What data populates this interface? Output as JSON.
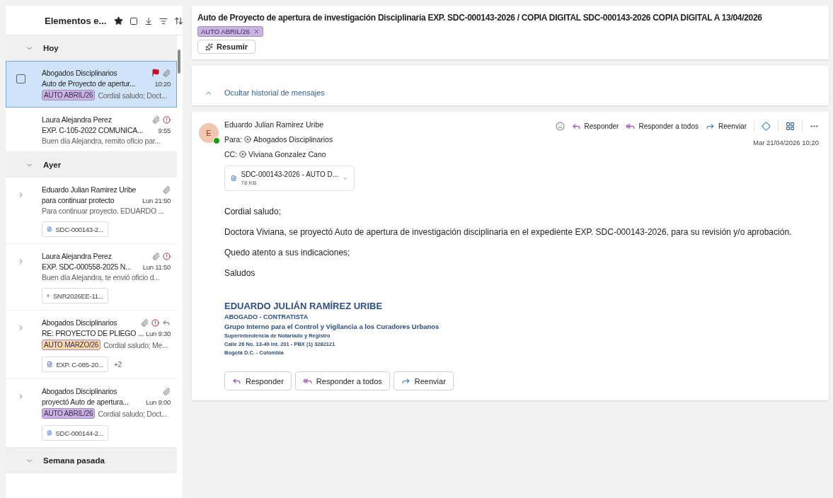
{
  "list": {
    "title": "Elementos e...",
    "groups": [
      {
        "label": "Hoy",
        "expanded": true,
        "items": [
          {
            "sender": "Abogados Disciplinarios",
            "subject": "Auto de Proyecto de apertur...",
            "time": "10:20",
            "preview": "Cordial saludo; Doct...",
            "tag": {
              "label": "AUTO ABRIL/26",
              "color": "#c9b3e0"
            },
            "selected": true,
            "thread": false,
            "flagged": true,
            "attachment": true,
            "important": false,
            "replied": false
          },
          {
            "sender": "Laura Alejandra Perez",
            "subject": "EXP. C-105-2022 COMUNICA...",
            "time": "9:55",
            "preview": "Buen día Alejandra, remito oficio par...",
            "selected": false,
            "thread": false,
            "flagged": false,
            "attachment": true,
            "important": true,
            "replied": false
          }
        ]
      },
      {
        "label": "Ayer",
        "expanded": true,
        "items": [
          {
            "sender": "Eduardo Julian Ramirez Uribe",
            "subject": "para continuar protecto",
            "time": "Lun 21:50",
            "preview": "Para continuar proyecto. EDUARDO ...",
            "selected": false,
            "thread": true,
            "flagged": false,
            "attachment": true,
            "important": false,
            "replied": false,
            "attachments": [
              {
                "name": "SDC-000143-2...",
                "kind": "word"
              }
            ]
          },
          {
            "sender": "Laura Alejandra Perez",
            "subject": "EXP. SDC-000558-2025 N...",
            "time": "Lun 11:50",
            "preview": "Buen día Alejandra, te envió oficio d...",
            "selected": false,
            "thread": true,
            "flagged": false,
            "attachment": true,
            "important": true,
            "replied": false,
            "attachments": [
              {
                "name": "SNR2026EE-11...",
                "kind": "pdf"
              }
            ]
          },
          {
            "sender": "Abogados Disciplinarios",
            "subject": "RE: PROYECTO DE PLIEGO ...",
            "time": "Lun 9:30",
            "preview": "Cordial saludo; Me...",
            "tag": {
              "label": "AUTO MARZO/26",
              "color": "#fcd9a8"
            },
            "selected": false,
            "thread": true,
            "flagged": false,
            "attachment": true,
            "important": true,
            "replied": true,
            "attachments": [
              {
                "name": "EXP. C-085-20...",
                "kind": "word"
              }
            ],
            "more": "+2"
          },
          {
            "sender": "Abogados Disciplinarios",
            "subject": "proyectó Auto de apertura...",
            "time": "Lun 9:00",
            "preview": "Cordial saludo; Doct...",
            "tag": {
              "label": "AUTO ABRIL/26",
              "color": "#c9b3e0"
            },
            "selected": false,
            "thread": true,
            "flagged": false,
            "attachment": true,
            "important": false,
            "replied": false,
            "attachments": [
              {
                "name": "SDC-000144-2...",
                "kind": "word"
              }
            ]
          }
        ]
      },
      {
        "label": "Semana pasada",
        "expanded": true
      }
    ]
  },
  "reading": {
    "subject": "Auto de Proyecto de apertura de investigación Disciplinaria EXP. SDC-000143-2026 / COPIA DIGITAL SDC-000143-2026  COPIA DIGITAL A 13/04/2026",
    "tag": {
      "label": "AUTO ABRIL/26",
      "color": "#c9b3e0"
    },
    "summarize": "Resumir",
    "history": "Ocultar historial de mensajes",
    "message": {
      "avatar": "E",
      "sender": "Eduardo Julian Ramirez Uribe",
      "to_label": "Para:",
      "to": "Abogados Disciplinarios",
      "cc_label": "CC:",
      "cc": "Viviana Gonzalez Cano",
      "date": "Mar 21/04/2026 10:20",
      "actions": [
        {
          "kind": "reply",
          "label": "Responder"
        },
        {
          "kind": "replyall",
          "label": "Responder a todos"
        },
        {
          "kind": "forward",
          "label": "Reenviar"
        }
      ],
      "file": {
        "name": "SDC-000143-2026 - AUTO D...",
        "size": "78 KB"
      },
      "body": [
        "Cordial saludo;",
        "Doctora Viviana, se proyectó Auto de apertura de investigación disciplinaria en el expediente EXP. SDC-000143-2026, para su revisión y/o aprobación.",
        "Quedo atento a sus indicaciones;",
        "Saludos"
      ],
      "signature": [
        {
          "kind": "name",
          "text": "EDUARDO JULIÁN RAMÍREZ URIBE"
        },
        {
          "kind": "role",
          "text": "ABOGADO - CONTRATISTA"
        },
        {
          "kind": "group",
          "text": "Grupo Interno para el Control y Vigilancia a los Curadores Urbanos"
        },
        {
          "kind": "small",
          "text": "Superintendencia de Notariado y Registro"
        },
        {
          "kind": "small",
          "text": "Calle 26 No. 13-49 Int. 201 - PBX (1) 3282121"
        },
        {
          "kind": "small",
          "text": "Bogotá D.C. - Colombia"
        }
      ],
      "buttons": [
        {
          "kind": "reply",
          "label": "Responder"
        },
        {
          "kind": "replyall",
          "label": "Responder a todos"
        },
        {
          "kind": "forward",
          "label": "Reenviar"
        }
      ]
    }
  }
}
